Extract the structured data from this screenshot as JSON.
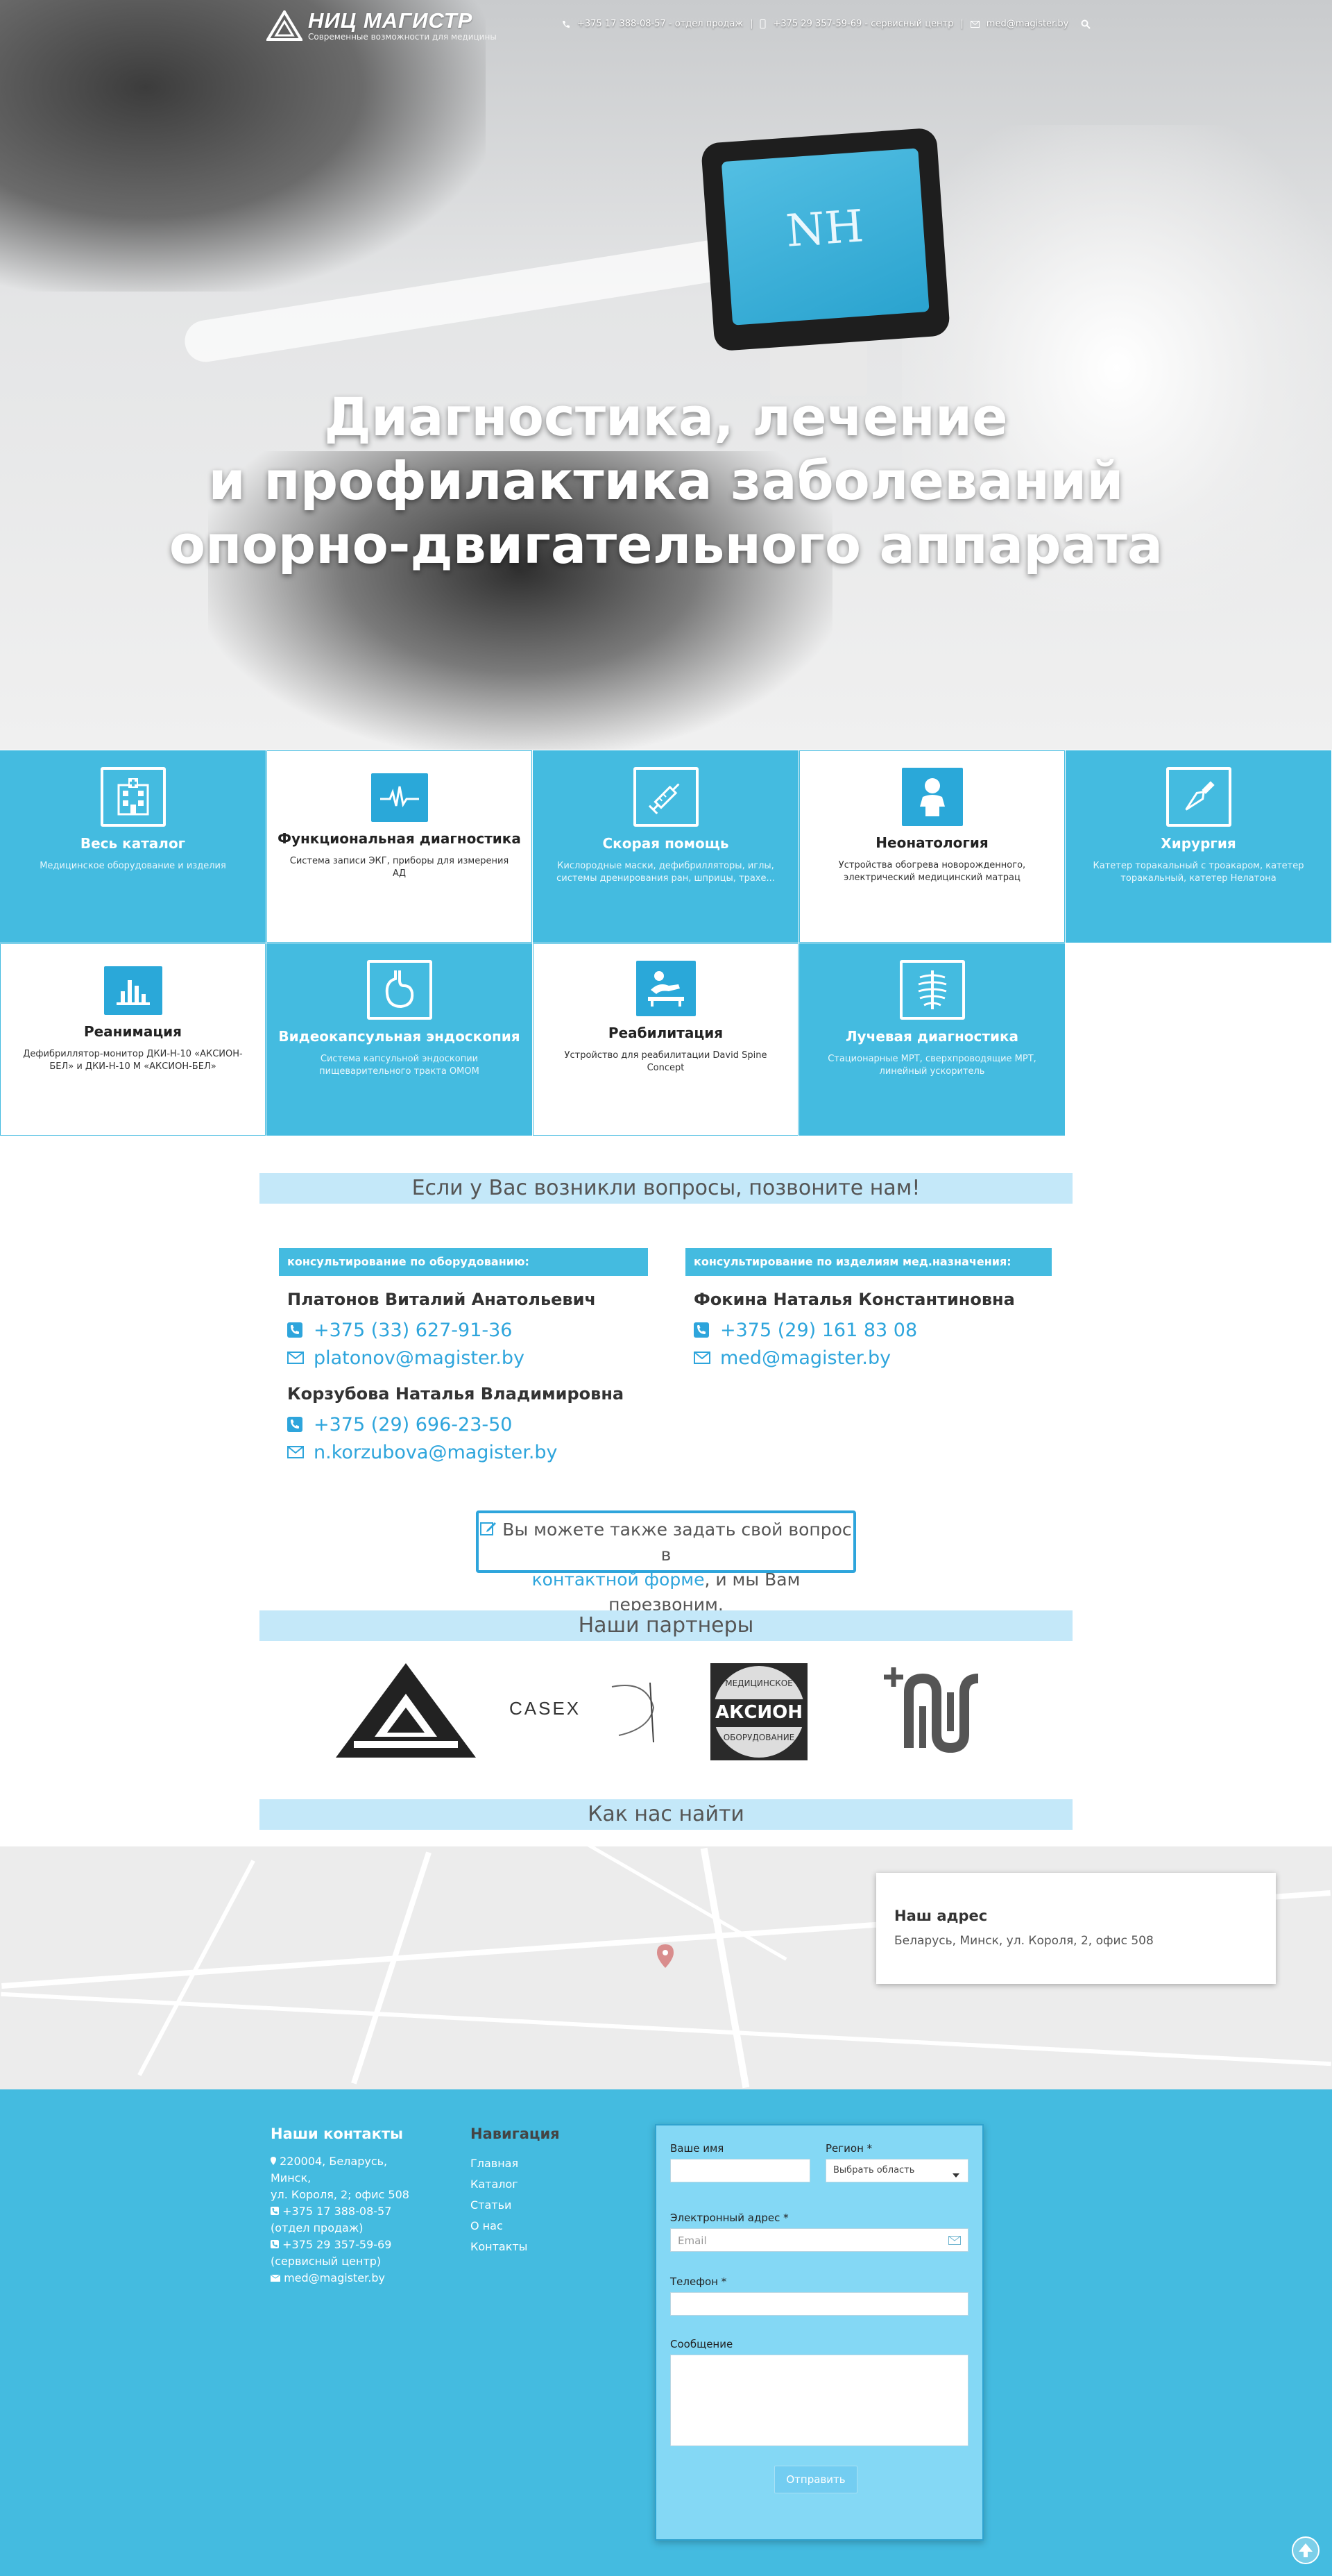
{
  "brand": {
    "name": "НИЦ МАГИСТР",
    "tagline": "Современные возможности для медицины"
  },
  "header": {
    "phone_sales": "+375 17 388-08-57 - отдел продаж",
    "phone_service": "+375 29 357-59-69 - сервисный центр",
    "email": "med@magister.by"
  },
  "hero": {
    "line1": "Диагностика, лечение",
    "line2": "и профилактика заболеваний",
    "line3": "опорно-двигательного аппарата",
    "screen_logo": "NH"
  },
  "categories": [
    {
      "title": "Весь каталог",
      "desc": "Медицинское оборудование и изделия",
      "icon": "hospital-icon",
      "style": "blue"
    },
    {
      "title": "Функциональная диагностика",
      "desc": "Система записи ЭКГ, приборы для измерения АД",
      "icon": "ecg-icon",
      "style": "white"
    },
    {
      "title": "Скорая помощь",
      "desc": "Кислородные маски, дефибрилляторы, иглы, системы дренирования ран, шприцы, трахе...",
      "icon": "syringe-icon",
      "style": "blue"
    },
    {
      "title": "Неонатология",
      "desc": "Устройства обогрева новорожденного, электрический медицинский матрац",
      "icon": "baby-icon",
      "style": "white"
    },
    {
      "title": "Хирургия",
      "desc": "Катетер торакальный с троакаром, катетер торакальный, катетер Нелатона",
      "icon": "scalpel-icon",
      "style": "blue"
    },
    {
      "title": "Реанимация",
      "desc": "Дефибриллятор-монитор ДКИ-Н-10 «АКСИОН-БЕЛ» и ДКИ-Н-10 М «АКСИОН-БЕЛ»",
      "icon": "monitor-icon",
      "style": "white"
    },
    {
      "title": "Видеокапсульная эндоскопия",
      "desc": "Система капсульной эндоскопии пищеварительного тракта OMOM",
      "icon": "stomach-icon",
      "style": "blue"
    },
    {
      "title": "Реабилитация",
      "desc": "Устройство для реабилитации David Spine Concept",
      "icon": "rehab-icon",
      "style": "white"
    },
    {
      "title": "Лучевая диагностика",
      "desc": "Стационарные МРТ, сверхпроводящие МРТ, линейный ускоритель",
      "icon": "xray-icon",
      "style": "blue"
    }
  ],
  "questions": {
    "title": "Если у Вас возникли вопросы, позвоните нам!",
    "left_head": "консультирование по оборудованию:",
    "right_head": "консультирование по изделиям мед.назначения:",
    "people": [
      {
        "name": "Платонов Виталий Анатольевич",
        "phone": "+375 (33) 627-91-36",
        "email": "platonov@magister.by"
      },
      {
        "name": "Корзубова Наталья Владимировна",
        "phone": "+375 (29) 696-23-50",
        "email": "n.korzubova@magister.by"
      },
      {
        "name": "Фокина Наталья Константиновна",
        "phone": "+375 (29) 161 83 08",
        "email": "med@magister.by"
      }
    ],
    "ask_pre": "Вы можете также задать свой вопрос в",
    "ask_link": "контактной форме",
    "ask_post": ", и мы Вам перезвоним."
  },
  "partners": {
    "title": "Наши партнеры",
    "casex": "CASEX",
    "akcion_top": "МЕДИЦИНСКОЕ",
    "akcion_name": "АКСИОН",
    "akcion_bottom": "ОБОРУДОВАНИЕ"
  },
  "find": {
    "title": "Как нас найти",
    "card_title": "Наш адрес",
    "card_address": "Беларусь, Минск, ул. Короля, 2, офис 508"
  },
  "footer": {
    "contacts_title": "Наши контакты",
    "address_1": "220004, Беларусь,",
    "address_2": "Минск,",
    "address_3": "ул. Короля, 2; офис 508",
    "phone1": "+375 17 388-08-57",
    "phone1_note": "(отдел продаж)",
    "phone2": "+375 29 357-59-69",
    "phone2_note": "(сервисный центр)",
    "email": "med@magister.by",
    "nav_title": "Навигация",
    "nav": [
      "Главная",
      "Каталог",
      "Статьи",
      "О нас",
      "Контакты"
    ]
  },
  "form": {
    "name_label": "Ваше имя",
    "region_label": "Регион *",
    "region_value": "Выбрать область",
    "email_label": "Электронный адрес *",
    "email_placeholder": "Email",
    "phone_label": "Телефон *",
    "message_label": "Сообщение",
    "submit": "Отправить"
  },
  "colors": {
    "accent": "#44bbe0",
    "link": "#2ea5dc",
    "section_bar": "#c4e8f9"
  }
}
